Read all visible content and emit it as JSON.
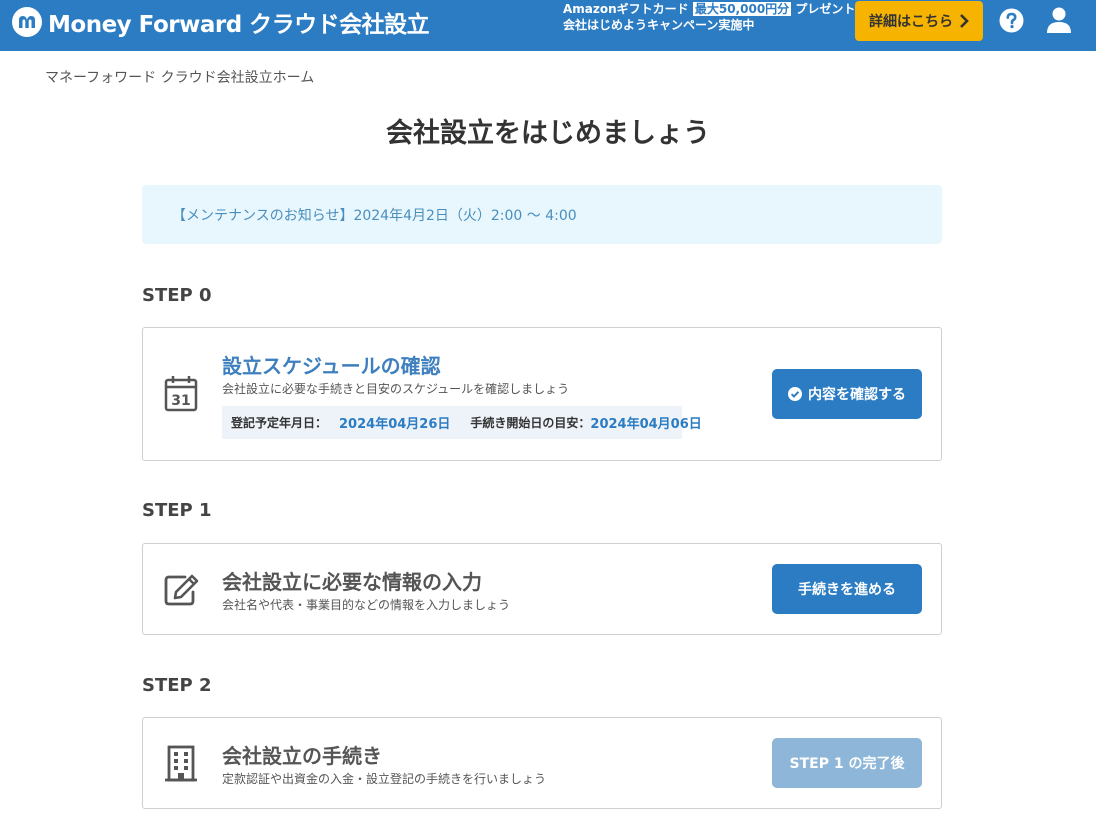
{
  "header": {
    "logo_text": "Money Forward クラウド会社設立",
    "promo_line1_pre": "Amazonギフトカード",
    "promo_line1_highlight": "最大50,000円分",
    "promo_line1_post": "プレゼント！",
    "promo_line2": "会社はじめようキャンペーン実施中",
    "promo_button": "詳細はこちら",
    "accent_color": "#2b7cc3",
    "promo_button_color": "#f6b400",
    "icons": [
      "help-icon",
      "user-icon"
    ]
  },
  "breadcrumb": "マネーフォワード クラウド会社設立ホーム",
  "page_title": "会社設立をはじめましょう",
  "notice": "【メンテナンスのお知らせ】2024年4月2日（火）2:00 〜 4:00",
  "steps": [
    {
      "label": "STEP 0",
      "title": "設立スケジュールの確認",
      "description": "会社設立に必要な手続きと目安のスケジュールを確認しましょう",
      "icon": "calendar-icon",
      "icon_text": "31",
      "button": "内容を確認する",
      "button_state": "enabled",
      "info": {
        "registration_label": "登記予定年月日：",
        "registration_value": "2024年04月26日",
        "start_label": "手続き開始日の目安：",
        "start_value": "2024年04月06日"
      }
    },
    {
      "label": "STEP 1",
      "title": "会社設立に必要な情報の入力",
      "description": "会社名や代表・事業目的などの情報を入力しましょう",
      "icon": "edit-icon",
      "button": "手続きを進める",
      "button_state": "enabled"
    },
    {
      "label": "STEP 2",
      "title": "会社設立の手続き",
      "description": "定款認証や出資金の入金・設立登記の手続きを行いましょう",
      "icon": "building-icon",
      "button": "STEP 1 の完了後",
      "button_state": "disabled"
    }
  ],
  "colors": {
    "primary_button": "#2b7cc3",
    "disabled_button": "#8db6d8",
    "step0_title": "#3d7fbf",
    "default_title": "#555555",
    "notice_bg": "#e8f6fd"
  }
}
